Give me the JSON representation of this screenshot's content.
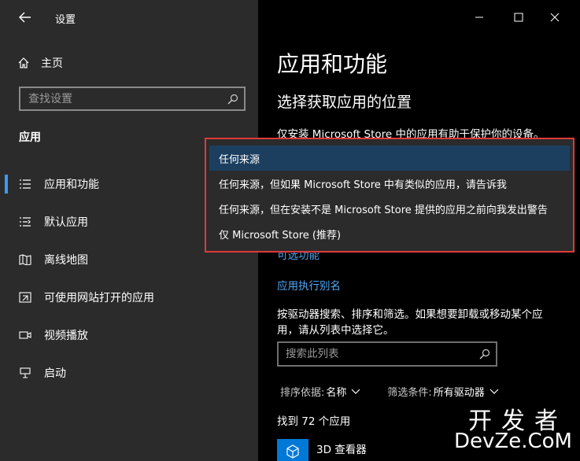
{
  "window": {
    "title": "设置"
  },
  "sidebar": {
    "home_label": "主页",
    "search_placeholder": "查找设置",
    "section_label": "应用",
    "items": [
      {
        "label": "应用和功能",
        "icon": "list-icon",
        "active": true
      },
      {
        "label": "默认应用",
        "icon": "default-apps-icon"
      },
      {
        "label": "离线地图",
        "icon": "map-icon"
      },
      {
        "label": "可使用网站打开的应用",
        "icon": "web-apps-icon"
      },
      {
        "label": "视频播放",
        "icon": "video-icon"
      },
      {
        "label": "启动",
        "icon": "startup-icon"
      }
    ]
  },
  "main": {
    "title": "应用和功能",
    "subtitle": "选择获取应用的位置",
    "description": "仅安装 Microsoft Store 中的应用有助于保护你的设备。",
    "link_optional": "可选功能",
    "link_alias": "应用执行别名",
    "paragraph": "按驱动器搜索、排序和筛选。如果想要卸载或移动某个应用，请从列表中选择它。",
    "list_search_placeholder": "搜索此列表",
    "sort_label": "排序依据:",
    "sort_value": "名称",
    "filter_label": "筛选条件:",
    "filter_value": "所有驱动器",
    "found_text": "找到 72 个应用",
    "first_app": "3D 查看器"
  },
  "dropdown": {
    "options": [
      "任何来源",
      "任何来源，但如果 Microsoft Store 中有类似的应用，请告诉我",
      "任何来源，但在安装不是 Microsoft Store 提供的应用之前向我发出警告",
      "仅 Microsoft Store (推荐)"
    ],
    "selected_index": 0
  },
  "watermark": {
    "top": "开发者",
    "bottom": "DevZe.CoM"
  },
  "colors": {
    "accent": "#3b9cf0",
    "link": "#4fa7f5",
    "highlight_border": "#e03a3a",
    "selected_option": "#1c3f60"
  }
}
